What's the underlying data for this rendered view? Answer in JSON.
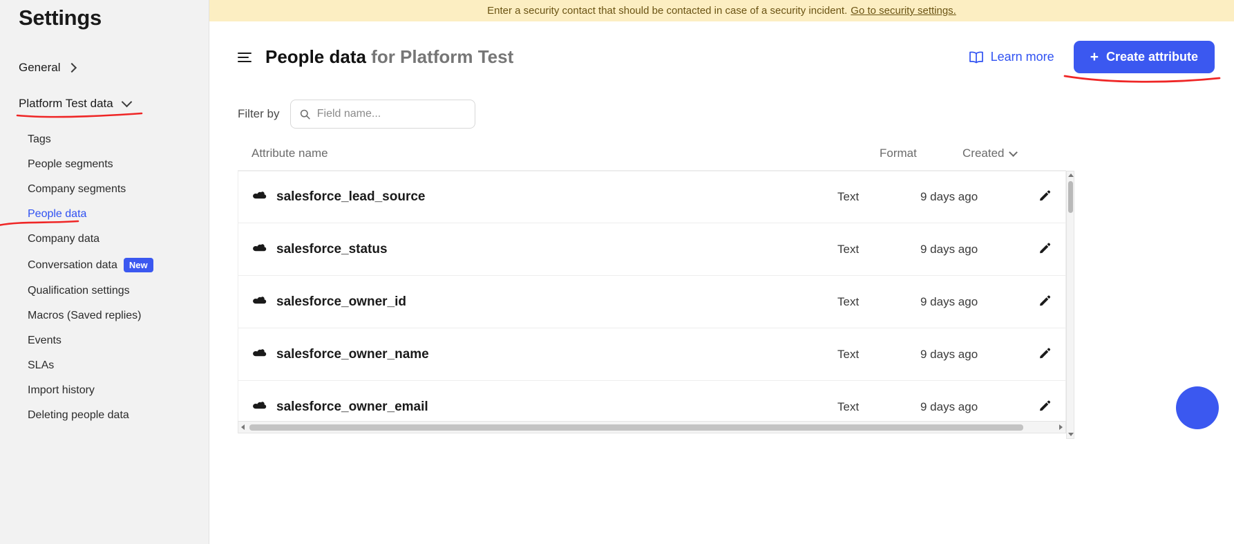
{
  "sidebar": {
    "title": "Settings",
    "top_items": [
      {
        "label": "General",
        "icon": "chevron-right-icon"
      },
      {
        "label": "Platform Test data",
        "icon": "chevron-down-icon"
      }
    ],
    "sub_items": [
      {
        "label": "Tags",
        "active": false
      },
      {
        "label": "People segments",
        "active": false
      },
      {
        "label": "Company segments",
        "active": false
      },
      {
        "label": "People data",
        "active": true
      },
      {
        "label": "Company data",
        "active": false
      },
      {
        "label": "Conversation data",
        "active": false,
        "badge": "New"
      },
      {
        "label": "Qualification settings",
        "active": false
      },
      {
        "label": "Macros (Saved replies)",
        "active": false
      },
      {
        "label": "Events",
        "active": false
      },
      {
        "label": "SLAs",
        "active": false
      },
      {
        "label": "Import history",
        "active": false
      },
      {
        "label": "Deleting people data",
        "active": false
      }
    ]
  },
  "banner": {
    "text": "Enter a security contact that should be contacted in case of a security incident.",
    "link_text": "Go to security settings.",
    "bg_color": "#fceec2",
    "text_color": "#6b5414"
  },
  "header": {
    "menu_icon": "hamburger-icon",
    "title_main": "People data",
    "title_suffix": " for Platform Test",
    "learn_more": {
      "label": "Learn more",
      "icon": "book-icon",
      "color": "#2f51f2"
    },
    "create_button": {
      "label": "Create attribute",
      "icon": "plus-icon",
      "color": "#3b58f0"
    }
  },
  "filter": {
    "label": "Filter by",
    "placeholder": "Field name...",
    "value": "",
    "icon": "search-icon"
  },
  "table": {
    "columns": {
      "name": "Attribute name",
      "format": "Format",
      "created": "Created",
      "created_sort_icon": "chevron-down-icon"
    },
    "rows": [
      {
        "icon": "salesforce-cloud-icon",
        "name": "salesforce_lead_source",
        "format": "Text",
        "created": "9 days ago",
        "edit_icon": "pencil-icon"
      },
      {
        "icon": "salesforce-cloud-icon",
        "name": "salesforce_status",
        "format": "Text",
        "created": "9 days ago",
        "edit_icon": "pencil-icon"
      },
      {
        "icon": "salesforce-cloud-icon",
        "name": "salesforce_owner_id",
        "format": "Text",
        "created": "9 days ago",
        "edit_icon": "pencil-icon"
      },
      {
        "icon": "salesforce-cloud-icon",
        "name": "salesforce_owner_name",
        "format": "Text",
        "created": "9 days ago",
        "edit_icon": "pencil-icon"
      },
      {
        "icon": "salesforce-cloud-icon",
        "name": "salesforce_owner_email",
        "format": "Text",
        "created": "9 days ago",
        "edit_icon": "pencil-icon"
      }
    ]
  },
  "annotations": {
    "color": "#ef2626",
    "marks": [
      "underline-platform-test-data",
      "underline-people-data",
      "underline-create-attribute"
    ]
  }
}
